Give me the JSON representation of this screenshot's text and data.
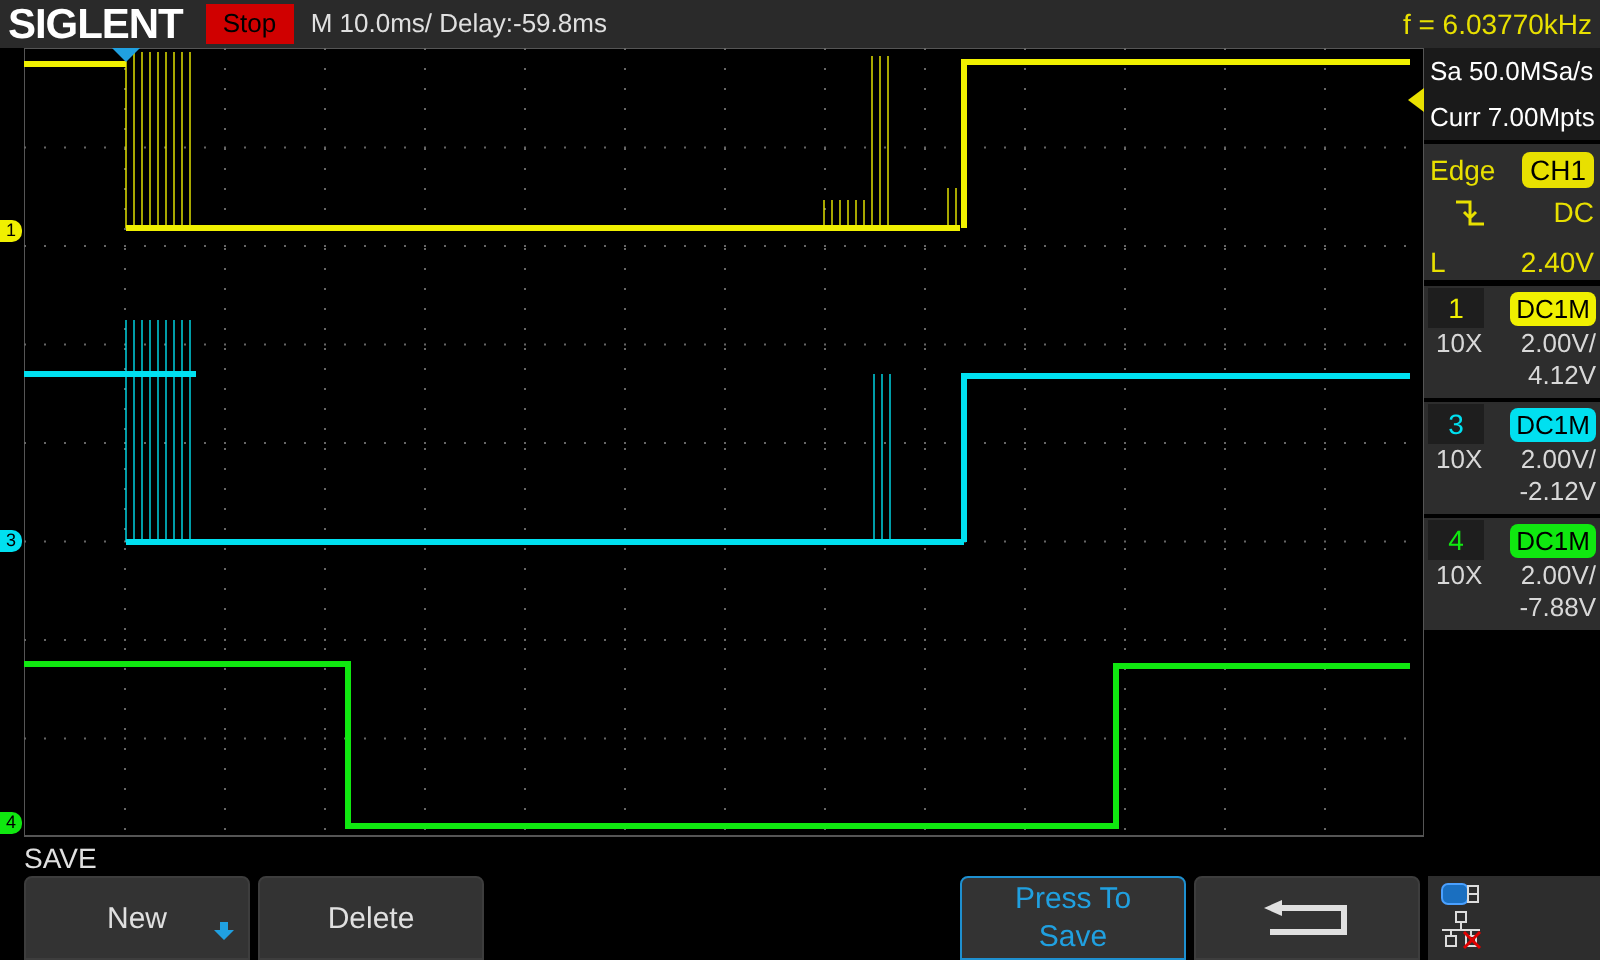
{
  "header": {
    "brand": "SIGLENT",
    "run_state": "Stop",
    "timebase": "M 10.0ms/ Delay:-59.8ms",
    "frequency": "f = 6.03770kHz"
  },
  "acquisition": {
    "sample_rate": "Sa 50.0MSa/s",
    "memory": "Curr 7.00Mpts"
  },
  "trigger": {
    "type": "Edge",
    "source": "CH1",
    "color": "#e8e000",
    "coupling": "DC",
    "level_label": "L",
    "level": "2.40V"
  },
  "channels": [
    {
      "number": "1",
      "marker_label": "1",
      "color": "#f0f000",
      "coupling": "DC1M",
      "probe": "10X",
      "scale": "2.00V/",
      "offset": "4.12V"
    },
    {
      "number": "3",
      "marker_label": "3",
      "color": "#00e0f0",
      "coupling": "DC1M",
      "probe": "10X",
      "scale": "2.00V/",
      "offset": "-2.12V"
    },
    {
      "number": "4",
      "marker_label": "4",
      "color": "#10e810",
      "coupling": "DC1M",
      "probe": "10X",
      "scale": "2.00V/",
      "offset": "-7.88V"
    }
  ],
  "menu": {
    "title": "SAVE",
    "buttons": [
      {
        "kind": "dropdown",
        "label": "New",
        "active": false
      },
      {
        "kind": "text",
        "label": "Delete",
        "active": false
      },
      {
        "kind": "empty"
      },
      {
        "kind": "empty"
      },
      {
        "kind": "text",
        "label": "Press To Save",
        "active": true
      },
      {
        "kind": "back",
        "active": false
      }
    ]
  }
}
